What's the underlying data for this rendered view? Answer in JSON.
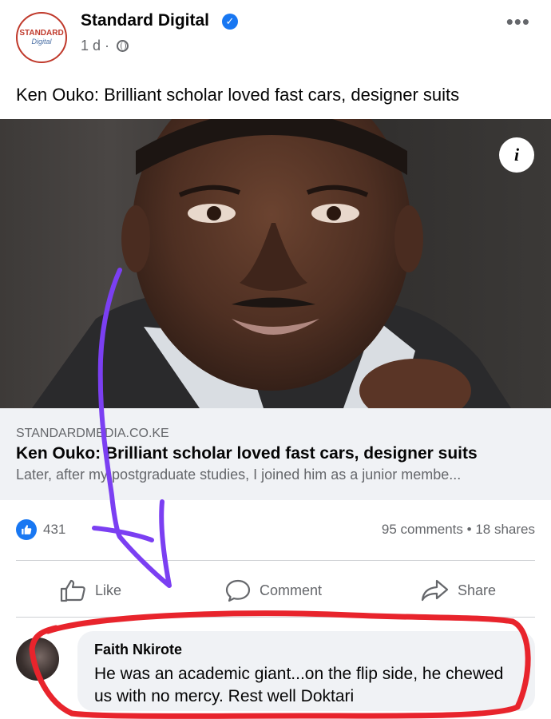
{
  "post": {
    "page_name": "Standard Digital",
    "avatar": {
      "line1": "STANDARD",
      "line2": "Digital"
    },
    "time": "1 d",
    "meta_sep": "·",
    "caption": "Ken Ouko: Brilliant scholar loved fast cars, designer suits",
    "info_icon_label": "i",
    "more_label": "•••"
  },
  "link_preview": {
    "domain": "STANDARDMEDIA.CO.KE",
    "title": "Ken Ouko: Brilliant scholar loved fast cars, designer suits",
    "description": "Later, after my postgraduate studies, I joined him as a junior membe..."
  },
  "stats": {
    "likes": "431",
    "comments": "95 comments",
    "separator": "•",
    "shares": "18 shares"
  },
  "actions": {
    "like": "Like",
    "comment": "Comment",
    "share": "Share"
  },
  "comment": {
    "author": "Faith Nkirote",
    "text": "He was an academic giant...on the flip side, he chewed us with no mercy. Rest well Doktari"
  },
  "icons": {
    "verified": "verified-check-icon",
    "globe": "globe-icon",
    "like": "thumbs-up-icon",
    "comment": "speech-bubble-icon",
    "share": "share-arrow-icon",
    "info": "info-icon",
    "more": "more-dots-icon"
  },
  "colors": {
    "facebook_blue": "#1877f2",
    "annotation_purple": "#7b3ff2",
    "annotation_red": "#e8242c",
    "muted_text": "#65676b"
  }
}
